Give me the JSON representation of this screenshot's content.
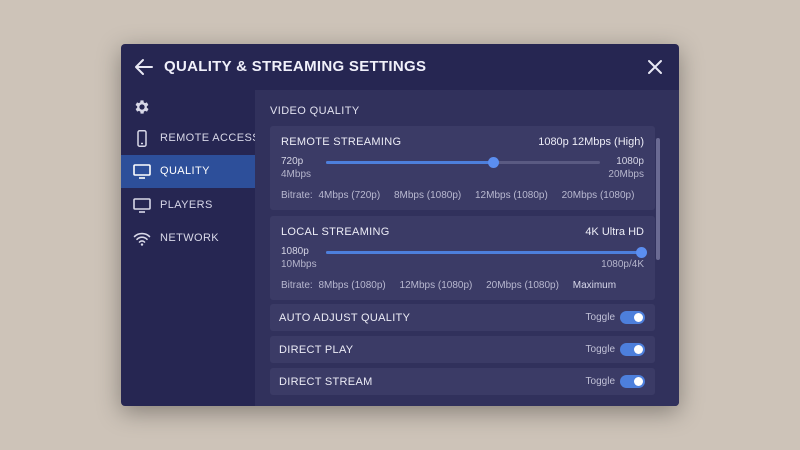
{
  "dialog": {
    "title": "QUALITY & STREAMING SETTINGS",
    "back_icon": "arrow-left-icon",
    "close_icon": "close-icon"
  },
  "sidebar": {
    "settings_icon": "gear-icon",
    "items": [
      {
        "label": "REMOTE ACCESS",
        "icon": "phone-icon",
        "active": false
      },
      {
        "label": "QUALITY",
        "icon": "monitor-icon",
        "active": true
      },
      {
        "label": "PLAYERS",
        "icon": "monitor-icon",
        "active": false
      },
      {
        "label": "NETWORK",
        "icon": "wifi-icon",
        "active": false
      }
    ]
  },
  "main": {
    "section_title": "VIDEO QUALITY",
    "remote": {
      "title": "REMOTE STREAMING",
      "value": "1080p 12Mbps (High)",
      "min_label": "720p",
      "min_sub": "4Mbps",
      "max_label": "1080p",
      "max_sub": "20Mbps",
      "level_pct": 61,
      "bitrate_prefix": "Bitrate:",
      "bitrates": [
        "4Mbps (720p)",
        "8Mbps (1080p)",
        "12Mbps (1080p)",
        "20Mbps (1080p)"
      ]
    },
    "local": {
      "title": "LOCAL STREAMING",
      "value": "4K Ultra HD",
      "min_label": "1080p",
      "min_sub": "10Mbps",
      "max_label": "1080p/4K",
      "level_pct": 100,
      "bitrate_prefix": "Bitrate:",
      "bitrates": [
        "8Mbps (1080p)",
        "12Mbps (1080p)",
        "20Mbps (1080p)",
        "Maximum"
      ]
    },
    "toggles": [
      {
        "label": "AUTO ADJUST QUALITY",
        "hint": "Toggle",
        "on": true
      },
      {
        "label": "DIRECT PLAY",
        "hint": "Toggle",
        "on": true
      },
      {
        "label": "DIRECT STREAM",
        "hint": "Toggle",
        "on": true
      }
    ]
  },
  "colors": {
    "accent": "#4d7fdc",
    "dialog_bg": "#262652",
    "content_bg": "#31315c",
    "card_bg": "#3b3b66",
    "active_nav": "#2d4f9a"
  }
}
